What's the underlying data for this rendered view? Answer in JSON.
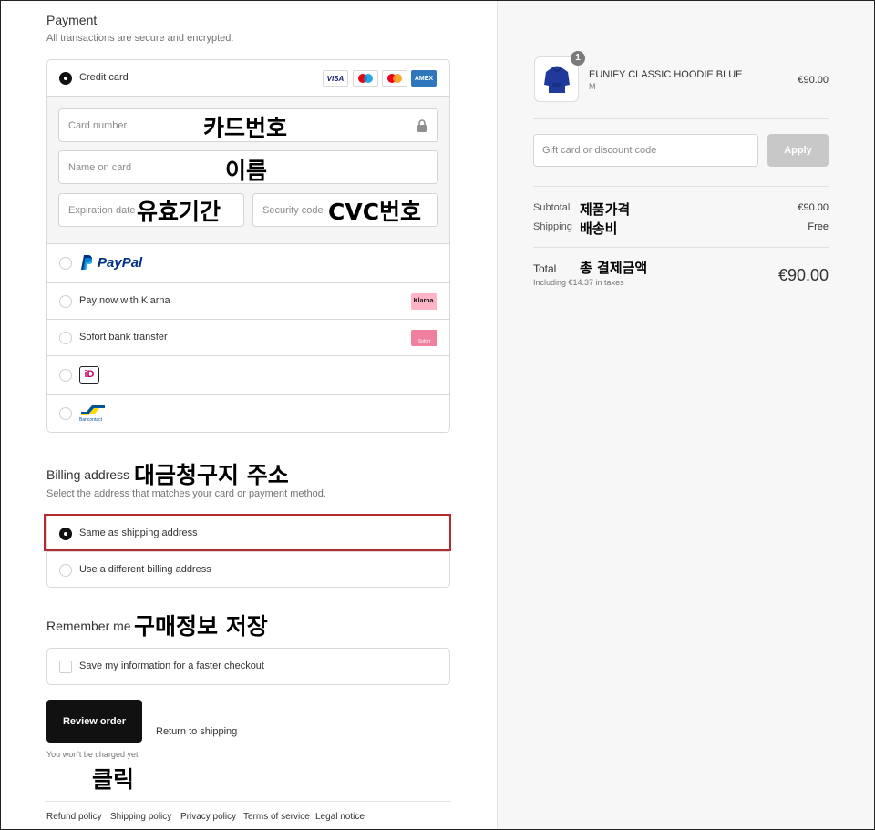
{
  "payment": {
    "title": "Payment",
    "subtitle": "All transactions are secure and encrypted.",
    "options": {
      "credit_card": "Credit card",
      "paypal_logo": "PayPal",
      "klarna": "Pay now with Klarna",
      "klarna_badge": "Klarna.",
      "sofort": "Sofort bank transfer",
      "sofort_badge": "Sofort",
      "ideal_logo": "iD",
      "bancontact_logo": "Bancontact"
    },
    "card_badges": [
      "VISA",
      "Maestro",
      "Mastercard",
      "AMEX"
    ],
    "fields": {
      "card_number": "Card number",
      "name_on_card": "Name on card",
      "expiration": "Expiration date",
      "security_code": "Security code"
    }
  },
  "billing": {
    "title": "Billing address",
    "subtitle": "Select the address that matches your card or payment method.",
    "same": "Same as shipping address",
    "different": "Use a different billing address"
  },
  "remember": {
    "title": "Remember me",
    "save": "Save my information for a faster checkout"
  },
  "actions": {
    "review": "Review order",
    "return": "Return to shipping",
    "note": "You won't be charged yet"
  },
  "footer": [
    "Refund policy",
    "Shipping policy",
    "Privacy policy",
    "Terms of service",
    "Legal notice"
  ],
  "summary": {
    "product_name": "EUNIFY CLASSIC HOODIE BLUE",
    "product_variant": "M",
    "product_price": "€90.00",
    "quantity": "1",
    "discount_placeholder": "Gift card or discount code",
    "apply": "Apply",
    "subtotal_label": "Subtotal",
    "subtotal_value": "€90.00",
    "shipping_label": "Shipping",
    "shipping_value": "Free",
    "total_label": "Total",
    "total_tax": "Including €14.37 in taxes",
    "total_value": "€90.00"
  },
  "annotations": {
    "card_number": "카드번호",
    "name": "이름",
    "expiration": "유효기간",
    "cvc": "CVC번호",
    "billing": "대금청구지 주소",
    "remember": "구매정보 저장",
    "click": "클릭",
    "subtotal": "제품가격",
    "shipping": "배송비",
    "total": "총 결제금액"
  },
  "colors": {
    "highlight_border": "#b32a2f",
    "primary_button": "#111111",
    "apply_button": "#c8c8c8",
    "summary_background": "#f7f7f7",
    "paypal_dark": "#003087",
    "paypal_light": "#009cde",
    "ideal_pink": "#cc0066",
    "bancontact_yellow": "#ffd800",
    "bancontact_blue": "#005498",
    "klarna_pink": "#ffb3c7",
    "sofort_pink": "#ef809f"
  }
}
